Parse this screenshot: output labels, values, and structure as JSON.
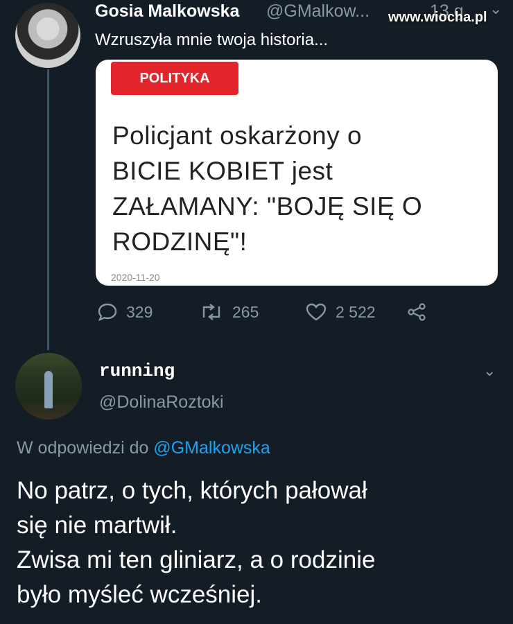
{
  "watermark": "www.wiocha.pl",
  "tweet": {
    "author_name": "Gosia Malkowska",
    "author_handle": "@GMalkow...",
    "time": "13 g",
    "text": "Wzruszyła mnie twoja historia...",
    "card": {
      "tag": "POLITYKA",
      "title_lines": [
        "Policjant oskarżony o",
        "BICIE KOBIET jest",
        "ZAŁAMANY: \"BOJĘ SIĘ O",
        "RODZINĘ\"!"
      ],
      "date": "2020-11-20"
    },
    "stats": {
      "replies": "329",
      "retweets": "265",
      "likes": "2 522"
    }
  },
  "reply": {
    "author_name": "running",
    "author_handle": "@DolinaRoztoki",
    "reply_prefix": "W odpowiedzi do",
    "reply_mention": "@GMalkowska",
    "text_lines": [
      "No patrz, o tych, których pałował",
      "się nie martwił.",
      "Zwisa mi ten gliniarz, a o rodzinie",
      "było myśleć wcześniej."
    ]
  },
  "icons": [
    "reply-icon",
    "retweet-icon",
    "like-icon",
    "share-icon",
    "chevron-down-icon"
  ],
  "colors": {
    "background": "#141d26",
    "muted": "#8899a6",
    "link": "#1da1f2",
    "tag_red": "#e2242b"
  }
}
